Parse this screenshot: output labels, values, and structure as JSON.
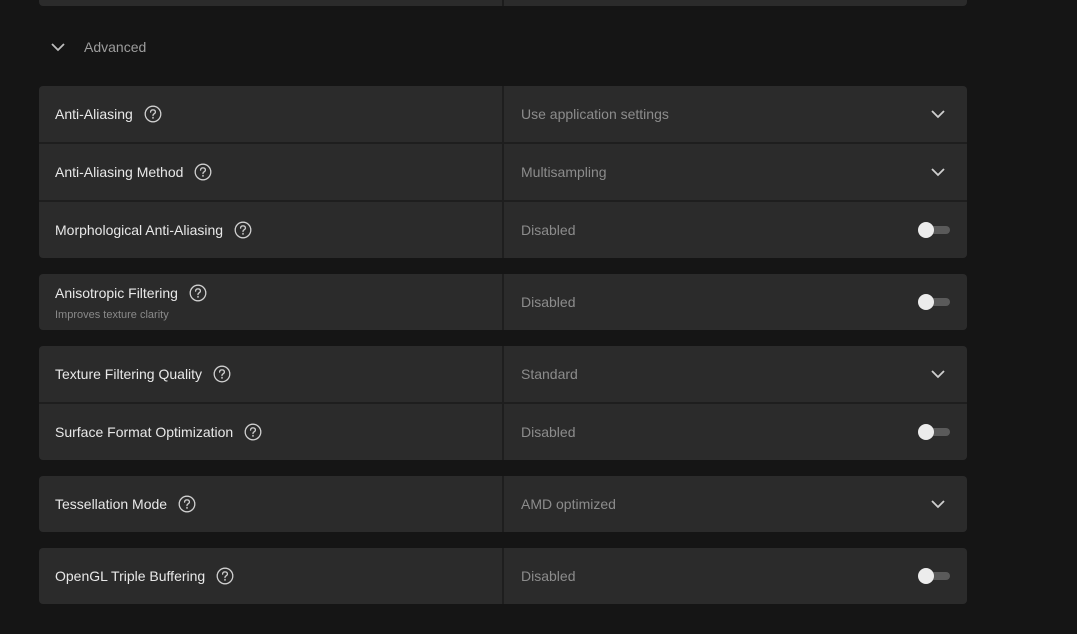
{
  "section": {
    "label": "Advanced",
    "expanded": true
  },
  "colors": {
    "background": "#151515",
    "card": "#2b2b2b",
    "label_text": "#e8e8e8",
    "value_text": "#8c8c8c",
    "toggle_off_track": "#5a5a5a",
    "toggle_knob": "#ececec"
  },
  "groups": [
    {
      "rows": [
        {
          "label": "Anti-Aliasing",
          "value": "Use application settings",
          "control": "dropdown",
          "icon": "help-icon"
        },
        {
          "label": "Anti-Aliasing Method",
          "value": "Multisampling",
          "control": "dropdown",
          "icon": "help-icon"
        },
        {
          "label": "Morphological Anti-Aliasing",
          "value": "Disabled",
          "control": "toggle",
          "enabled": false,
          "icon": "help-icon"
        }
      ]
    },
    {
      "rows": [
        {
          "label": "Anisotropic Filtering",
          "subtitle": "Improves texture clarity",
          "value": "Disabled",
          "control": "toggle",
          "enabled": false,
          "icon": "help-icon"
        }
      ]
    },
    {
      "rows": [
        {
          "label": "Texture Filtering Quality",
          "value": "Standard",
          "control": "dropdown",
          "icon": "help-icon"
        },
        {
          "label": "Surface Format Optimization",
          "value": "Disabled",
          "control": "toggle",
          "enabled": false,
          "icon": "help-icon"
        }
      ]
    },
    {
      "rows": [
        {
          "label": "Tessellation Mode",
          "value": "AMD optimized",
          "control": "dropdown",
          "icon": "help-icon"
        }
      ]
    },
    {
      "rows": [
        {
          "label": "OpenGL Triple Buffering",
          "value": "Disabled",
          "control": "toggle",
          "enabled": false,
          "icon": "help-icon"
        }
      ]
    }
  ]
}
